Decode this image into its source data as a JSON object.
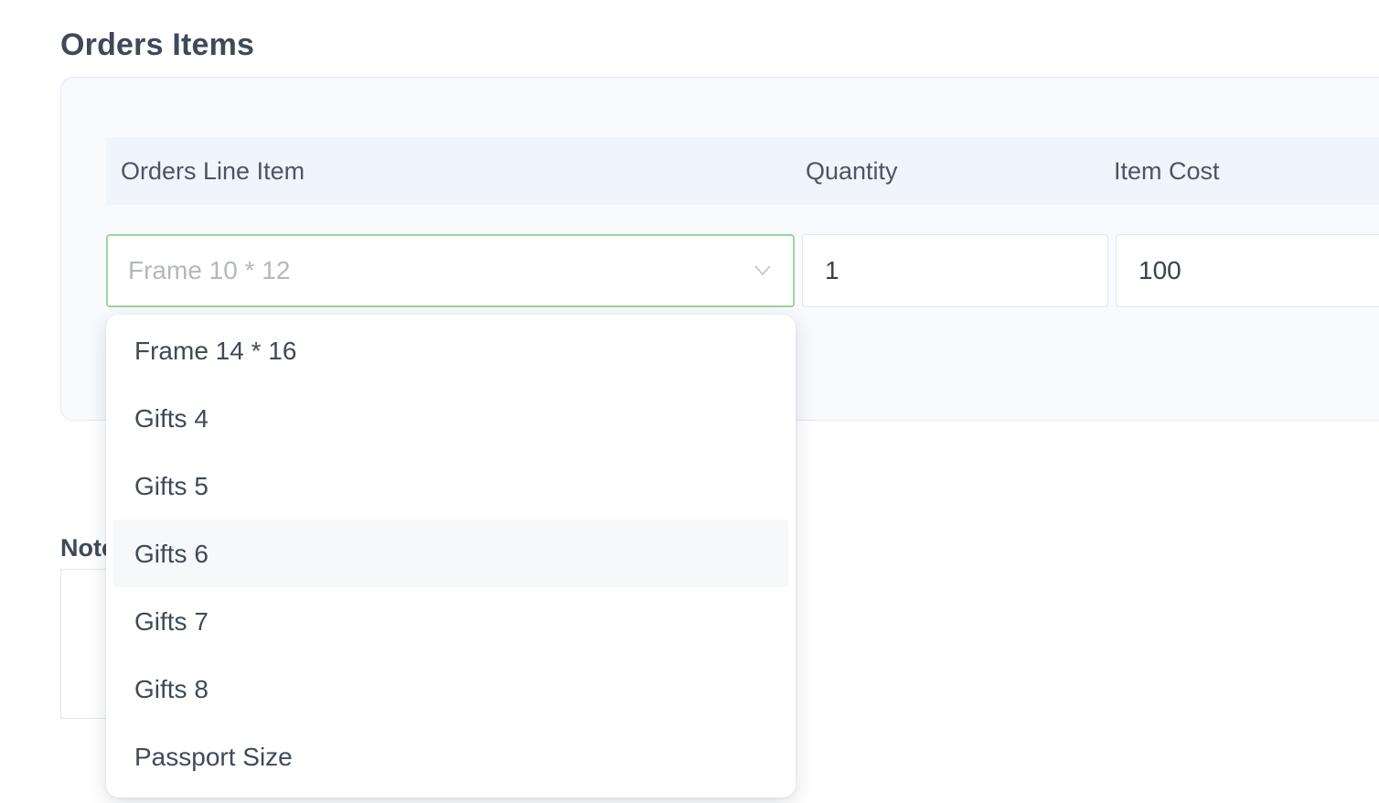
{
  "section": {
    "title": "Orders Items"
  },
  "table": {
    "headers": [
      "Orders Line Item",
      "Quantity",
      "Item Cost"
    ]
  },
  "row": {
    "line_item": "Frame 10 * 12",
    "quantity": "1",
    "item_cost": "100"
  },
  "notes": {
    "label": "Note"
  },
  "dropdown": {
    "options": [
      "Frame 14 * 16",
      "Gifts 4",
      "Gifts 5",
      "Gifts 6",
      "Gifts 7",
      "Gifts 8",
      "Passport Size"
    ],
    "hovered_option": "Gifts 6"
  },
  "icons": {
    "select_chevron": "chevron-down-icon"
  },
  "colors": {
    "select_focus_border": "#9fd3a0",
    "card_background": "#f8fafd",
    "header_background": "#f0f5fc"
  }
}
